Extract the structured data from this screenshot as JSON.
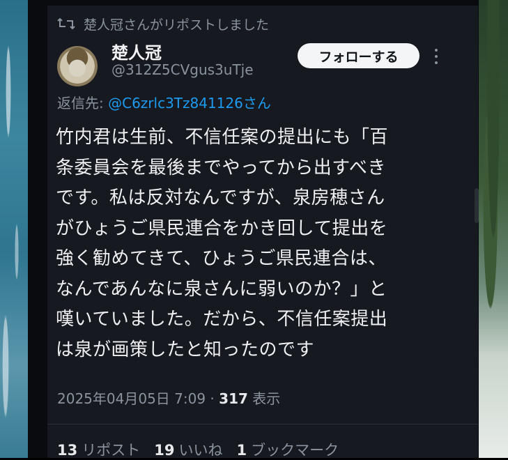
{
  "repost": {
    "icon": "repost-icon",
    "text": "楚人冠さんがリポストしました"
  },
  "author": {
    "name": "楚人冠",
    "handle": "@312Z5CVgus3uTje",
    "avatar": "avatar"
  },
  "follow_label": "フォローする",
  "more_icon": "more-vertical-icon",
  "reply": {
    "prefix": "返信先: ",
    "target": "@C6zrlc3Tz841126さん"
  },
  "body": "竹内君は生前、不信任案の提出にも「百\n条委員会を最後までやってから出すべき\nです。私は反対なんですが、泉房穂さん\nがひょうご県民連合をかき回して提出を\n強く勧めてきて、ひょうご県民連合は、\nなんであんなに泉さんに弱いのか？」と\n嘆いていました。だから、不信任案提出\nは泉が画策したと知ったのです",
  "meta": {
    "timestamp": "2025年04月05日 7:09",
    "separator": " · ",
    "views": "317",
    "views_label": " 表示"
  },
  "stats": [
    {
      "count": "13",
      "label": "リポスト"
    },
    {
      "count": "19",
      "label": "いいね"
    },
    {
      "count": "1",
      "label": "ブックマーク"
    }
  ]
}
